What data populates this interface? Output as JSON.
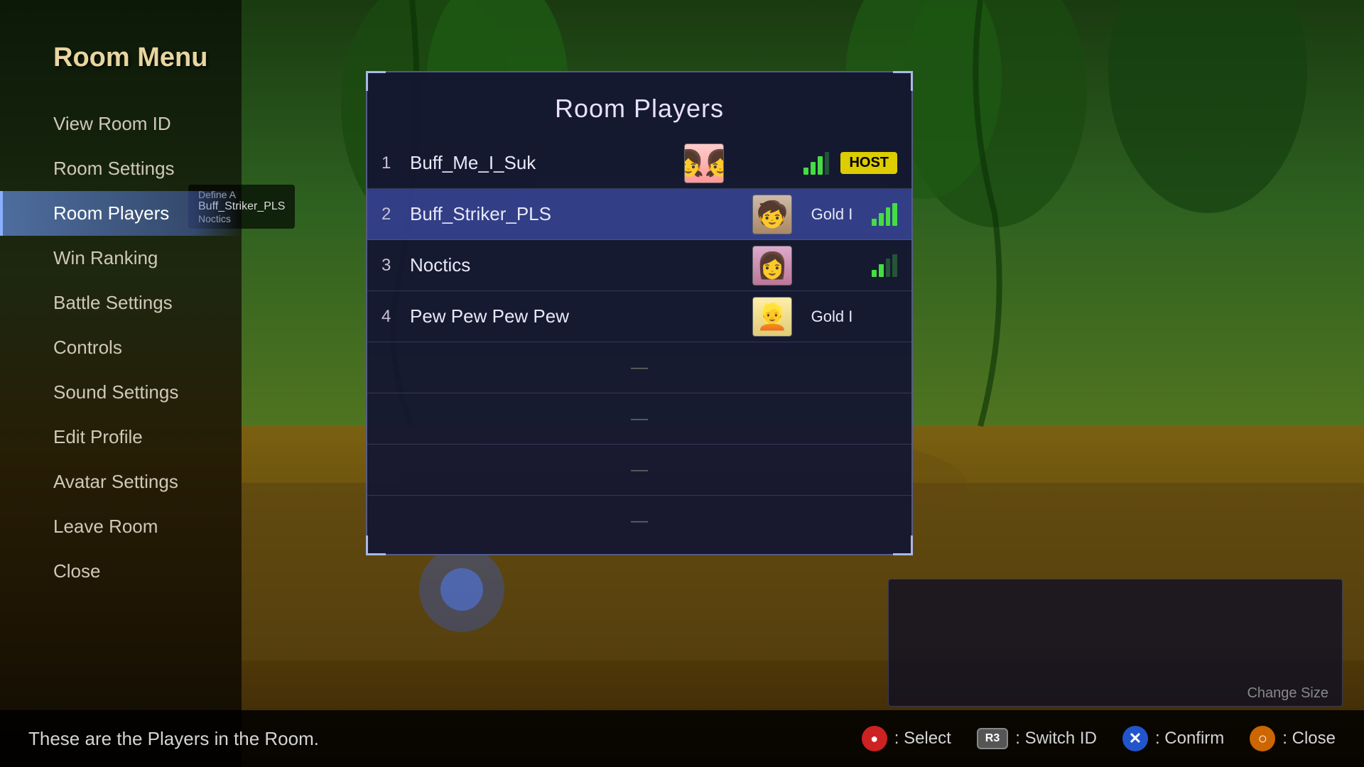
{
  "title": "Room Menu",
  "sidebar": {
    "items": [
      {
        "id": "view-room-id",
        "label": "View Room ID",
        "active": false
      },
      {
        "id": "room-settings",
        "label": "Room Settings",
        "active": false
      },
      {
        "id": "room-players",
        "label": "Room Players",
        "active": true
      },
      {
        "id": "win-ranking",
        "label": "Win Ranking",
        "active": false
      },
      {
        "id": "battle-settings",
        "label": "Battle Settings",
        "active": false
      },
      {
        "id": "controls",
        "label": "Controls",
        "active": false
      },
      {
        "id": "sound-settings",
        "label": "Sound Settings",
        "active": false
      },
      {
        "id": "edit-profile",
        "label": "Edit Profile",
        "active": false
      },
      {
        "id": "avatar-settings",
        "label": "Avatar Settings",
        "active": false
      },
      {
        "id": "leave-room",
        "label": "Leave Room",
        "active": false
      },
      {
        "id": "close",
        "label": "Close",
        "active": false
      }
    ]
  },
  "dialog": {
    "title": "Room Players",
    "players": [
      {
        "number": "1",
        "name": "Buff_Me_I_Suk",
        "rank": "",
        "is_host": true,
        "signal": "medium",
        "avatar_class": "avatar-1"
      },
      {
        "number": "2",
        "name": "Buff_Striker_PLS",
        "rank": "Gold I",
        "is_host": false,
        "signal": "medium",
        "avatar_class": "avatar-2",
        "highlighted": true
      },
      {
        "number": "3",
        "name": "Noctics",
        "rank": "",
        "is_host": false,
        "signal": "medium",
        "avatar_class": "avatar-3"
      },
      {
        "number": "4",
        "name": "Pew Pew Pew Pew",
        "rank": "Gold I",
        "is_host": false,
        "signal": "none",
        "avatar_class": "avatar-4"
      }
    ],
    "empty_slots": 4,
    "empty_dash": "—"
  },
  "status_bar": {
    "hint": "These are the Players in the Room.",
    "controls": [
      {
        "id": "select",
        "button_type": "circle",
        "button_color": "red",
        "button_label": "●",
        "action_label": ": Select"
      },
      {
        "id": "switch-id",
        "button_type": "r3",
        "button_label": "R3",
        "action_label": ": Switch ID"
      },
      {
        "id": "confirm",
        "button_type": "circle",
        "button_color": "blue",
        "button_label": "✕",
        "action_label": ": Confirm"
      },
      {
        "id": "close",
        "button_type": "circle",
        "button_color": "orange",
        "button_label": "○",
        "action_label": ": Close"
      }
    ]
  },
  "misc": {
    "host_label": "HOST",
    "change_size_hint": "Change Size"
  }
}
